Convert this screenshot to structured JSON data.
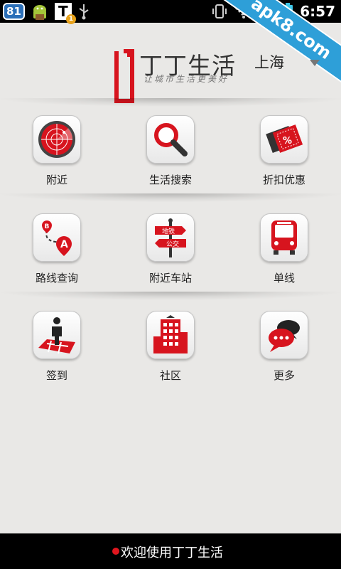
{
  "status_bar": {
    "notification_count": "81",
    "time": "6:57",
    "icons": [
      "android-icon",
      "t-app-icon",
      "usb-icon",
      "vibrate-icon",
      "wifi-icon",
      "signal-icon",
      "battery-icon"
    ]
  },
  "watermark": {
    "text": "apk8.com"
  },
  "header": {
    "app_title": "丁丁生活",
    "slogan": "让城市生活更美好",
    "city": "上海"
  },
  "grid": [
    {
      "label": "附近",
      "icon": "radar-icon"
    },
    {
      "label": "生活搜索",
      "icon": "magnifier-icon"
    },
    {
      "label": "折扣优惠",
      "icon": "discount-ticket-icon"
    },
    {
      "label": "路线查询",
      "icon": "route-icon"
    },
    {
      "label": "附近车站",
      "icon": "signpost-icon",
      "sign_top": "地铁",
      "sign_bottom": "公交"
    },
    {
      "label": "单线",
      "icon": "bus-icon"
    },
    {
      "label": "签到",
      "icon": "checkin-person-icon"
    },
    {
      "label": "社区",
      "icon": "building-icon"
    },
    {
      "label": "更多",
      "icon": "chat-bubbles-icon"
    }
  ],
  "route_badges": {
    "start": "B",
    "end": "A"
  },
  "footer": {
    "text": "欢迎使用丁丁生活"
  },
  "colors": {
    "accent": "#d7141e",
    "background": "#e9e8e6",
    "bar": "#000000"
  }
}
